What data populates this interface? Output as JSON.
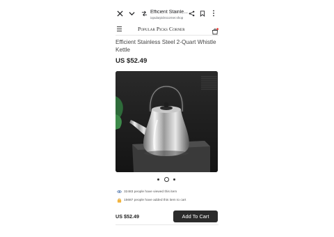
{
  "browser": {
    "tab_title": "Efficient Stainle...",
    "url": "iopularpickscorner.shop"
  },
  "site": {
    "brand": "Popular Picks Corner"
  },
  "product": {
    "title": "Efficient Stainless Steel 2-Quart Whistle Kettle",
    "price": "US $52.49",
    "views_text": "32483 people have viewed this item",
    "added_text": "15687 people have added this item to cart"
  },
  "carousel": {
    "slide_count": 3,
    "active_slide": 2
  },
  "bottom_bar": {
    "price": "US $52.49",
    "add_to_cart_label": "Add To Cart"
  },
  "icons": {
    "close": "close-icon",
    "menu": "chevron-down-icon",
    "tabs": "tune-icon",
    "share": "share-icon",
    "bookmark": "bookmark-icon",
    "more": "more-vert-icon",
    "hamburger": "hamburger-icon",
    "cart": "cart-icon",
    "views": "eye-icon",
    "added": "cart-badge-icon"
  }
}
